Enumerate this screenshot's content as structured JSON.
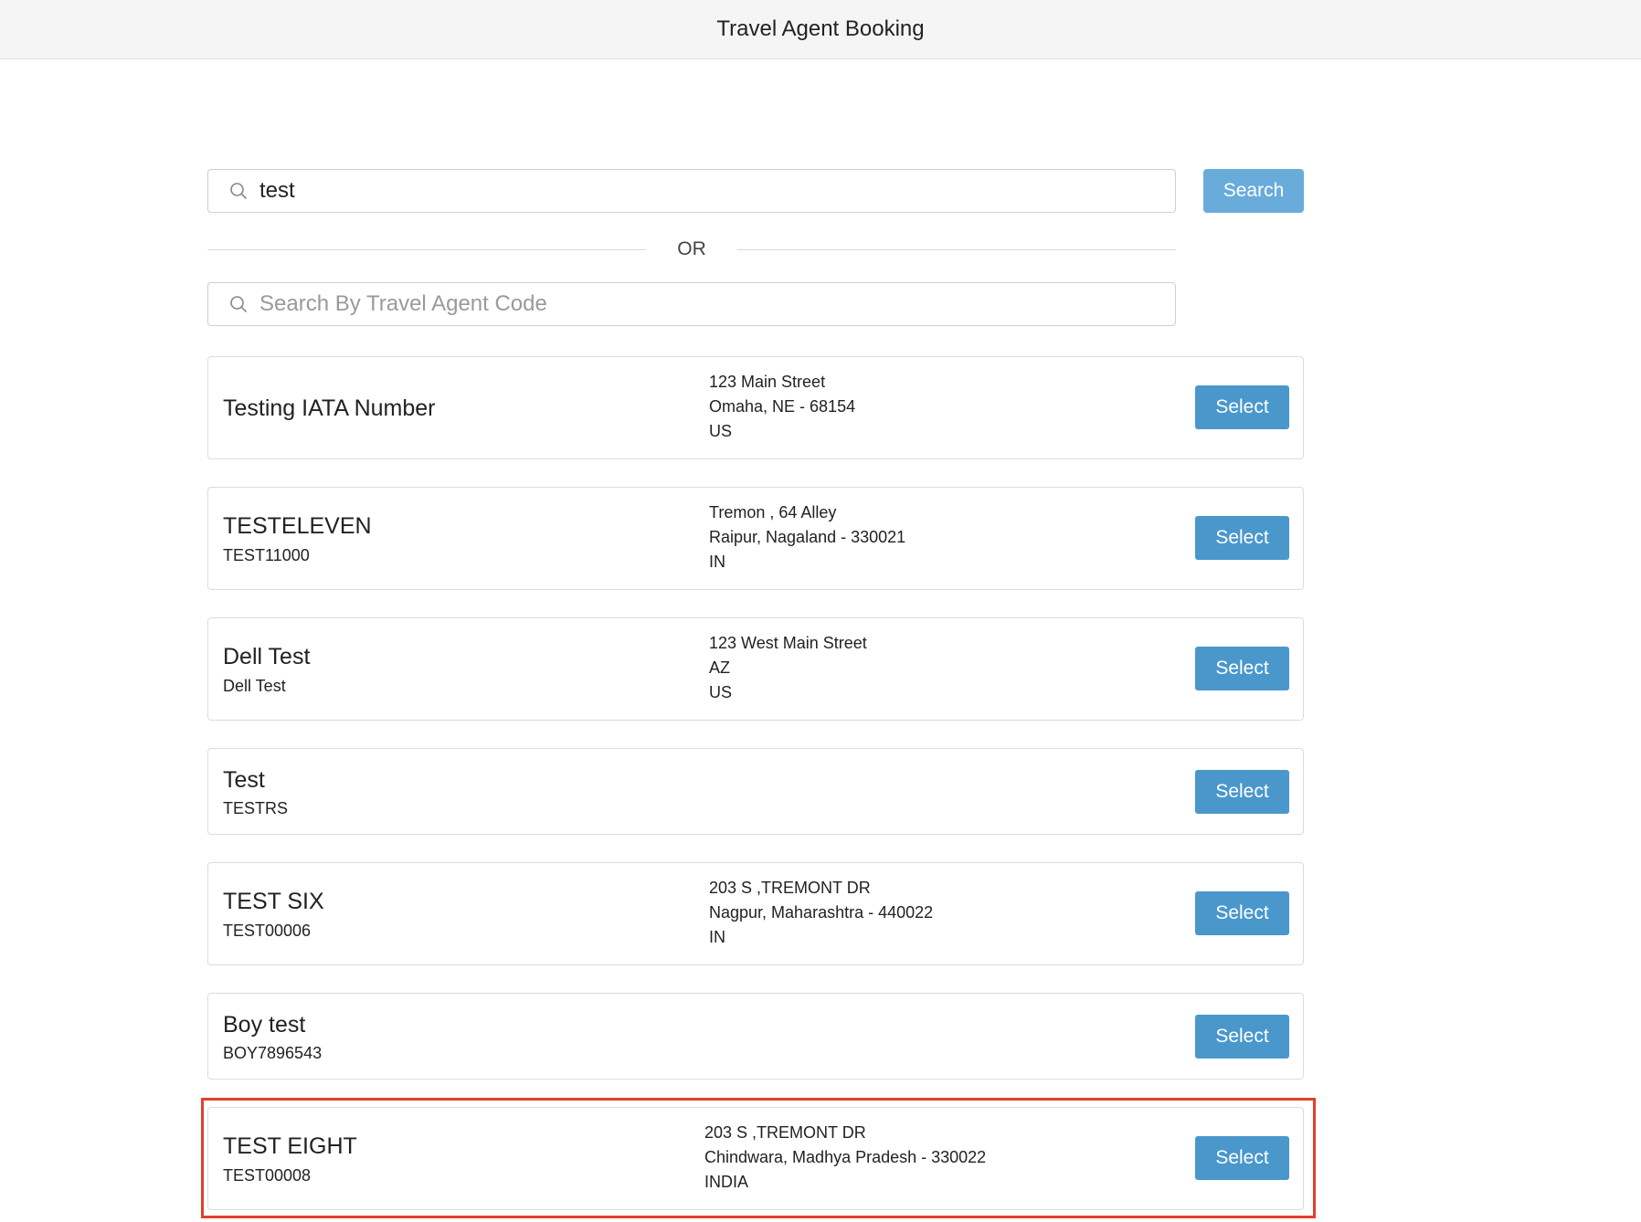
{
  "header": {
    "title": "Travel Agent Booking"
  },
  "search": {
    "value": "test",
    "button_label": "Search",
    "or_label": "OR",
    "code_placeholder": "Search By Travel Agent Code"
  },
  "results": [
    {
      "name": "Testing IATA Number",
      "code": "",
      "addr1": "123 Main Street",
      "addr2": "Omaha,  NE  - 68154",
      "addr3": "US",
      "select_label": "Select"
    },
    {
      "name": "TESTELEVEN",
      "code": "TEST11000",
      "addr1": "Tremon , 64 Alley",
      "addr2": "Raipur,  Nagaland  - 330021",
      "addr3": "IN",
      "select_label": "Select"
    },
    {
      "name": "Dell Test",
      "code": "Dell Test",
      "addr1": "123 West Main Street",
      "addr2": "AZ",
      "addr3": "US",
      "select_label": "Select"
    },
    {
      "name": "Test",
      "code": "TESTRS",
      "addr1": "",
      "addr2": "",
      "addr3": "",
      "select_label": "Select"
    },
    {
      "name": "TEST SIX",
      "code": "TEST00006",
      "addr1": "203 S ,TREMONT DR",
      "addr2": "Nagpur,  Maharashtra  - 440022",
      "addr3": "IN",
      "select_label": "Select"
    },
    {
      "name": "Boy test",
      "code": "BOY7896543",
      "addr1": "",
      "addr2": "",
      "addr3": "",
      "select_label": "Select"
    },
    {
      "name": "TEST EIGHT",
      "code": "TEST00008",
      "addr1": "203 S ,TREMONT DR",
      "addr2": "Chindwara,  Madhya Pradesh  - 330022",
      "addr3": "INDIA",
      "select_label": "Select"
    }
  ],
  "colors": {
    "accent": "#4a97cc",
    "search_button": "#69acdb",
    "highlight": "#e0412d"
  }
}
